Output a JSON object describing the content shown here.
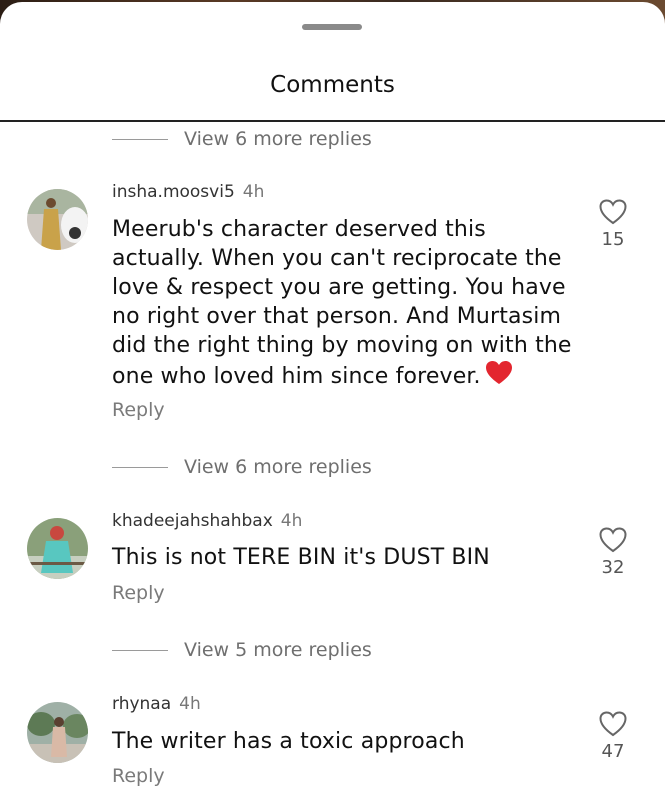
{
  "sheet": {
    "title": "Comments"
  },
  "threads": [
    {
      "view_replies": "View 6 more replies"
    },
    {
      "author": "insha.moosvi5",
      "time": "4h",
      "text": "Meerub's character deserved this actually. When you can't reciprocate the love & respect you are getting. You have no right over that person. And Murtasim did the right thing by moving on with the one who loved him since forever.",
      "emoji": "heart-emoji",
      "reply_label": "Reply",
      "likes": "15",
      "view_replies": "View 6 more replies"
    },
    {
      "author": "khadeejahshahbax",
      "time": "4h",
      "text": "This is not TERE BIN it's DUST BIN",
      "reply_label": "Reply",
      "likes": "32",
      "view_replies": "View 5 more replies"
    },
    {
      "author": "rhynaa",
      "time": "4h",
      "text": "The writer has a toxic approach",
      "reply_label": "Reply",
      "likes": "47"
    }
  ],
  "icons": {
    "like": "heart-outline-icon",
    "emoji": "red-heart-emoji"
  },
  "colors": {
    "emoji_red": "#e3262f",
    "muted_text": "#7a7a7a"
  }
}
